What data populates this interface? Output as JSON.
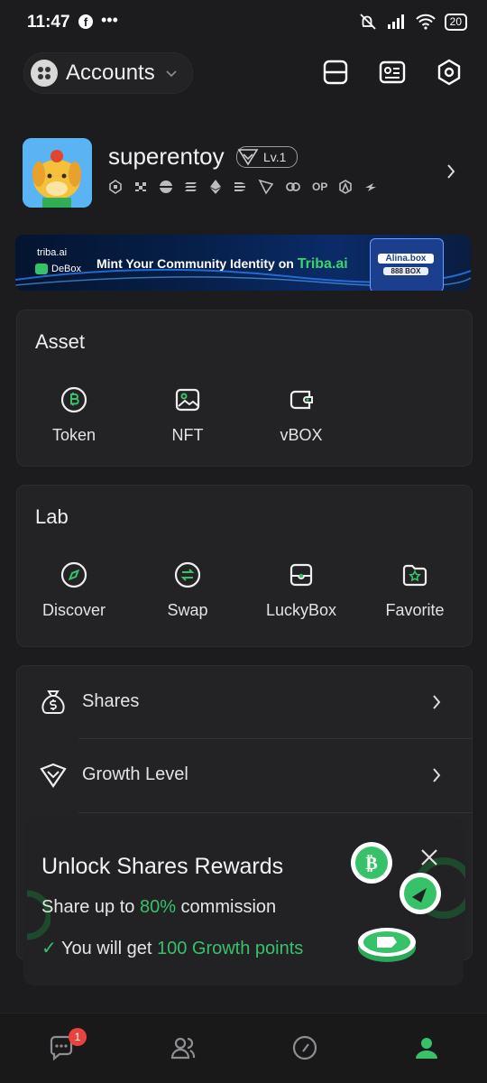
{
  "status_bar": {
    "time": "11:47",
    "battery": "20"
  },
  "header": {
    "accounts_label": "Accounts"
  },
  "profile": {
    "username": "superentoy",
    "level": "Lv.1",
    "chains": [
      "BNB",
      "ZKS",
      "Base",
      "Solana",
      "ETH",
      "Linea",
      "Tron",
      "Link",
      "OP",
      "Arb",
      "Blast"
    ],
    "op_label": "OP"
  },
  "banner": {
    "brand_top": "triba.ai",
    "brand_bottom": "DeBox",
    "text": "Mint Your Community Identity on ",
    "highlight": "Triba.ai",
    "card_name": "Alina.box",
    "card_amount": "888 BOX"
  },
  "asset": {
    "title": "Asset",
    "items": [
      {
        "label": "Token",
        "icon": "bitcoin-icon"
      },
      {
        "label": "NFT",
        "icon": "image-icon"
      },
      {
        "label": "vBOX",
        "icon": "wallet-icon"
      }
    ]
  },
  "lab": {
    "title": "Lab",
    "items": [
      {
        "label": "Discover",
        "icon": "compass-icon"
      },
      {
        "label": "Swap",
        "icon": "swap-icon"
      },
      {
        "label": "LuckyBox",
        "icon": "luckybox-icon"
      },
      {
        "label": "Favorite",
        "icon": "star-folder-icon"
      }
    ]
  },
  "menu": [
    {
      "label": "Shares",
      "icon": "money-bag-icon"
    },
    {
      "label": "Growth Level",
      "icon": "heart-badge-icon"
    }
  ],
  "popup": {
    "title": "Unlock Shares Rewards",
    "line1_prefix": "Share up to ",
    "line1_highlight": "80%",
    "line1_suffix": " commission",
    "line2_prefix": "You will get ",
    "line2_highlight": "100 Growth points"
  },
  "bottom_nav": {
    "chat_badge": "1"
  },
  "colors": {
    "accent": "#37c26a",
    "background": "#1c1c1e",
    "card": "#232325",
    "badge": "#e8433f"
  }
}
